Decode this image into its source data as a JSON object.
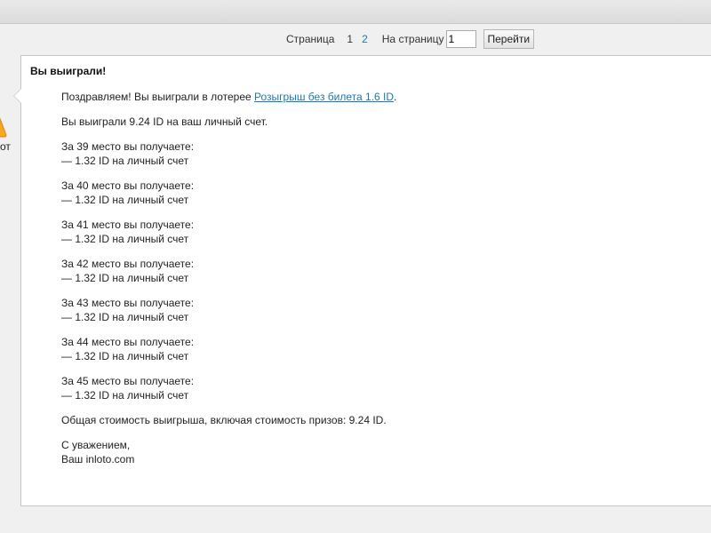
{
  "pager": {
    "label": "Страница",
    "pages": [
      "1",
      "2"
    ],
    "per_page_label": "На страницу",
    "per_page_value": "1",
    "go_label": "Перейти"
  },
  "left_fragment": {
    "text": "от",
    "icon": "warning-triangle-icon"
  },
  "message": {
    "title": "Вы выиграли!",
    "intro_prefix": "Поздравляем! Вы выиграли в лотерее ",
    "lottery_link": "Розыгрыш без билета 1.6 ID",
    "intro_suffix": ".",
    "total_line": "Вы выиграли 9.24 ID на ваш личный счет.",
    "places": [
      {
        "line1": "За 39 место вы получаете:",
        "line2": "— 1.32 ID на личный счет"
      },
      {
        "line1": "За 40 место вы получаете:",
        "line2": "— 1.32 ID на личный счет"
      },
      {
        "line1": "За 41 место вы получаете:",
        "line2": "— 1.32 ID на личный счет"
      },
      {
        "line1": "За 42 место вы получаете:",
        "line2": "— 1.32 ID на личный счет"
      },
      {
        "line1": "За 43 место вы получаете:",
        "line2": "— 1.32 ID на личный счет"
      },
      {
        "line1": "За 44 место вы получаете:",
        "line2": "— 1.32 ID на личный счет"
      },
      {
        "line1": "За 45 место вы получаете:",
        "line2": "— 1.32 ID на личный счет"
      }
    ],
    "summary": "Общая стоимость выигрыша, включая стоимость призов: 9.24 ID.",
    "signoff1": "С уважением,",
    "signoff2": "Ваш inloto.com"
  },
  "colors": {
    "link": "#1a78b0",
    "warning": "#f5a623"
  }
}
